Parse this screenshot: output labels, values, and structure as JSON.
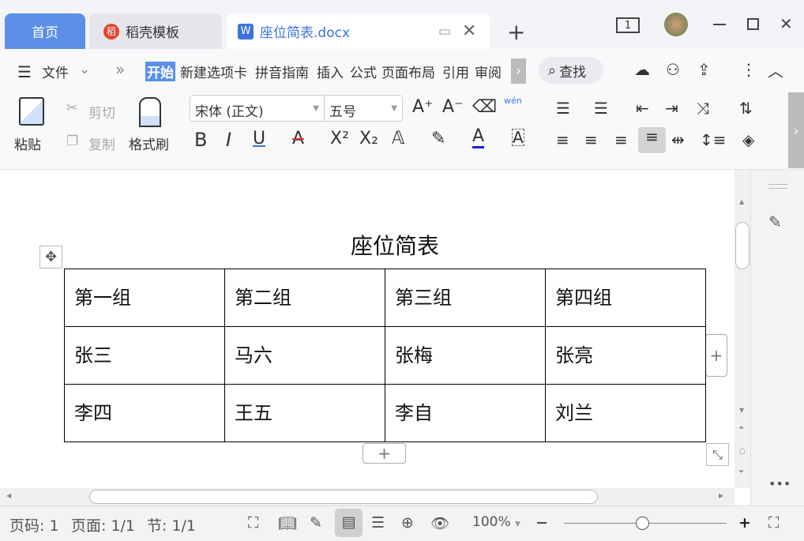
{
  "tabs": {
    "home": "首页",
    "daoke": "稻壳模板",
    "doc": "座位简表.docx",
    "new": "+"
  },
  "window": {
    "badge": "1"
  },
  "menu": {
    "file": "文件",
    "more": "»",
    "tabs": [
      "开始",
      "新建选项卡",
      "拼音指南",
      "插入",
      "公式",
      "页面布局",
      "引用",
      "审阅"
    ],
    "search": "查找"
  },
  "ribbon": {
    "paste": "粘贴",
    "cut": "剪切",
    "copy": "复制",
    "format_painter": "格式刷",
    "font": "宋体 (正文)",
    "size": "五号",
    "pinyin": "wén"
  },
  "document": {
    "title": "座位简表",
    "table": [
      [
        "第一组",
        "第二组",
        "第三组",
        "第四组"
      ],
      [
        "张三",
        "马六",
        "张梅",
        "张亮"
      ],
      [
        "李四",
        "王五",
        "李自",
        "刘兰"
      ]
    ],
    "add": "+"
  },
  "status": {
    "page_num": "页码: 1",
    "pages": "页面: 1/1",
    "section": "节: 1/1",
    "zoom": "100%",
    "zoom_fraction": 0.5
  },
  "colors": {
    "accent": "#5b8fe8"
  }
}
